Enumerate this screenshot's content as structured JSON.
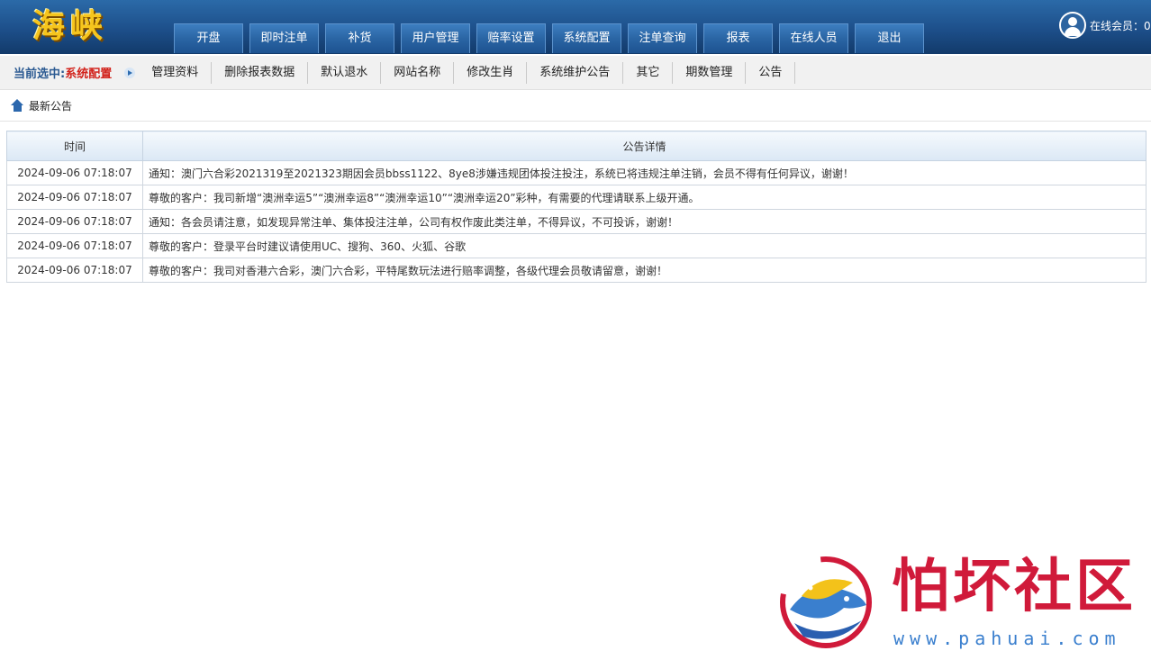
{
  "header": {
    "logo_text": "海峡",
    "nav": [
      "开盘",
      "即时注单",
      "补货",
      "用户管理",
      "赔率设置",
      "系统配置",
      "注单查询",
      "报表",
      "在线人员",
      "退出"
    ],
    "online_label": "在线会员：0"
  },
  "subnav": {
    "current_label": "当前选中:",
    "current_value": "系统配置",
    "items": [
      "管理资料",
      "删除报表数据",
      "默认退水",
      "网站名称",
      "修改生肖",
      "系统维护公告",
      "其它",
      "期数管理",
      "公告"
    ]
  },
  "breadcrumb": {
    "title": "最新公告"
  },
  "table": {
    "headers": [
      "时间",
      "公告详情"
    ],
    "rows": [
      {
        "time": "2024-09-06 07:18:07",
        "detail": "通知：澳门六合彩2021319至2021323期因会员bbss1122、8ye8涉嫌违规团体投注投注，系统已将违规注单注销，会员不得有任何异议，谢谢！"
      },
      {
        "time": "2024-09-06 07:18:07",
        "detail": "尊敬的客户：我司新增“澳洲幸运5”“澳洲幸运8”“澳洲幸运10”“澳洲幸运20”彩种，有需要的代理请联系上级开通。"
      },
      {
        "time": "2024-09-06 07:18:07",
        "detail": "通知：各会员请注意，如发现异常注单、集体投注注单，公司有权作废此类注单，不得异议，不可投诉，谢谢！"
      },
      {
        "time": "2024-09-06 07:18:07",
        "detail": "尊敬的客户：登录平台时建议请使用UC、搜狗、360、火狐、谷歌"
      },
      {
        "time": "2024-09-06 07:18:07",
        "detail": "尊敬的客户：我司对香港六合彩，澳门六合彩，平特尾数玩法进行赔率调整，各级代理会员敬请留意，谢谢！"
      }
    ]
  },
  "watermark": {
    "title": "怕坏社区",
    "url": "www.pahuai.com"
  }
}
